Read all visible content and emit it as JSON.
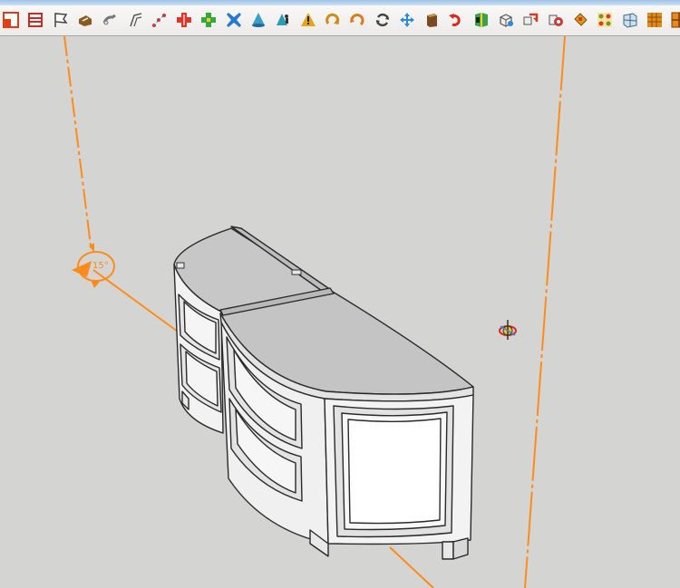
{
  "toolbar": {
    "tools": [
      {
        "id": "select",
        "icon": "select-tool-icon",
        "color": "#e23b17"
      },
      {
        "id": "section-plane",
        "icon": "section-plane-icon",
        "color": "#cc2a22"
      },
      {
        "id": "flag",
        "icon": "flag-icon",
        "color": "#444444"
      },
      {
        "id": "tape",
        "icon": "tape-measure-icon",
        "color": "#8a5a22"
      },
      {
        "id": "link",
        "icon": "link-icon",
        "color": "#777777"
      },
      {
        "id": "corner",
        "icon": "corner-tool-icon",
        "color": "#555555"
      },
      {
        "id": "points",
        "icon": "points-tool-icon",
        "color": "#d8332a"
      },
      {
        "id": "add-red",
        "icon": "add-red-icon",
        "color": "#e0332a"
      },
      {
        "id": "add-green",
        "icon": "add-green-icon",
        "color": "#34a83a"
      },
      {
        "id": "remove-blue",
        "icon": "remove-blue-icon",
        "color": "#2878d0"
      },
      {
        "id": "cone",
        "icon": "cone-tool-icon",
        "color": "#3aa0c8"
      },
      {
        "id": "cone-person",
        "icon": "cone-person-icon",
        "color": "#2f9ab8"
      },
      {
        "id": "caution",
        "icon": "caution-triangle-icon",
        "color": "#e8a417"
      },
      {
        "id": "rotate-a",
        "icon": "rotate-a-icon",
        "color": "#d48a1a"
      },
      {
        "id": "rotate-b",
        "icon": "rotate-b-icon",
        "color": "#e07a1a"
      },
      {
        "id": "rotate-c",
        "icon": "rotate-c-icon",
        "color": "#444444"
      },
      {
        "id": "move",
        "icon": "move-tool-icon",
        "color": "#2a8ae0"
      },
      {
        "id": "pushpull",
        "icon": "push-pull-icon",
        "color": "#7b4a22"
      },
      {
        "id": "undo",
        "icon": "undo-curve-icon",
        "color": "#d62a22"
      },
      {
        "id": "scale",
        "icon": "scale-tool-icon",
        "color": "#3aa04a"
      },
      {
        "id": "component",
        "icon": "component-icon",
        "color": "#555555"
      },
      {
        "id": "group-a",
        "icon": "group-a-icon",
        "color": "#d63a22"
      },
      {
        "id": "group-b",
        "icon": "group-b-icon",
        "color": "#c83a3a"
      },
      {
        "id": "paint",
        "icon": "paint-bucket-icon",
        "color": "#d8a018"
      },
      {
        "id": "pattern",
        "icon": "pattern-grid-icon",
        "color": "#8a8a20"
      },
      {
        "id": "grid",
        "icon": "grid-box-icon",
        "color": "#3a6a8a"
      },
      {
        "id": "texture",
        "icon": "texture-tile-icon",
        "color": "#e08a18"
      },
      {
        "id": "tile-grid",
        "icon": "tile-grid-icon",
        "color": "#e88a1a"
      }
    ]
  },
  "viewport": {
    "background": "#d4d4d2",
    "guide_color": "#ff8c1a",
    "protractor_label": "15°",
    "model": "curved-cabinet"
  }
}
